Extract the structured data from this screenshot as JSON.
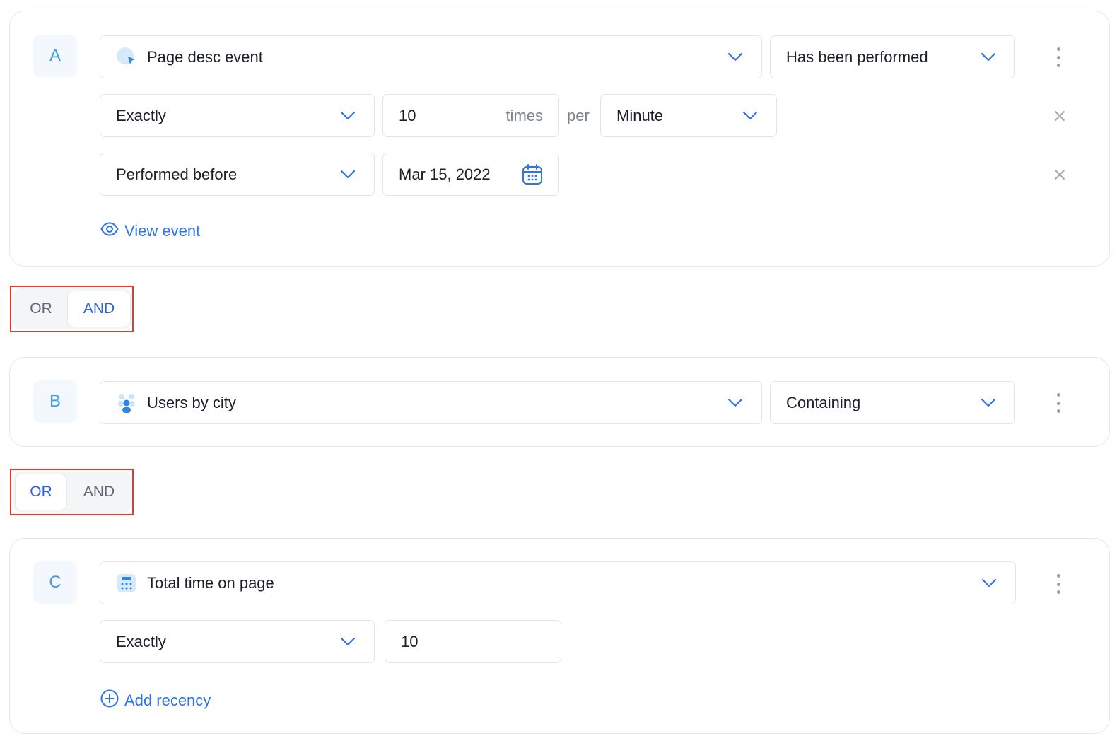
{
  "groups": [
    {
      "badge": "A",
      "event_field": {
        "label": "Page desc event",
        "icon": "cursor-click-icon"
      },
      "condition_select": "Has been performed",
      "rows": {
        "frequency": {
          "mode": "Exactly",
          "value": "10",
          "unit_suffix": "times",
          "per_label": "per",
          "period": "Minute"
        },
        "timing": {
          "mode": "Performed before",
          "date": "Mar 15, 2022"
        }
      },
      "link": {
        "label": "View event",
        "icon": "eye-icon"
      }
    },
    {
      "badge": "B",
      "event_field": {
        "label": "Users by city",
        "icon": "users-icon"
      },
      "condition_select": "Containing"
    },
    {
      "badge": "C",
      "event_field": {
        "label": "Total time on page",
        "icon": "calculator-icon"
      },
      "rows": {
        "comparison": {
          "mode": "Exactly",
          "value": "10"
        }
      },
      "link": {
        "label": "Add recency",
        "icon": "plus-circle-icon"
      }
    }
  ],
  "connectors": [
    {
      "or_label": "OR",
      "and_label": "AND",
      "selected": "AND"
    },
    {
      "or_label": "OR",
      "and_label": "AND",
      "selected": "OR"
    }
  ],
  "colors": {
    "accent": "#2f74e0",
    "badge_text": "#3b9fe6",
    "highlight_border": "#e23b2c"
  }
}
